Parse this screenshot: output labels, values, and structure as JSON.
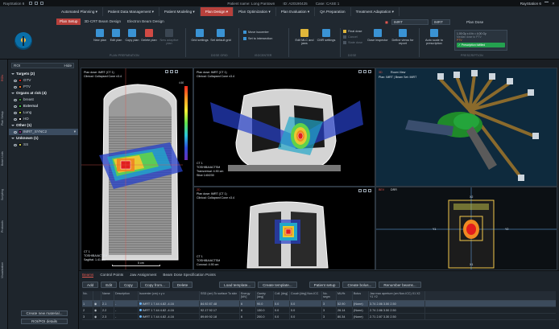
{
  "titlebar": {
    "app_name": "RayStation 6",
    "patient_label": "Patient name: Long Pantown",
    "patient_id": "ID: A20190425",
    "case_label": "Case: CASE 1",
    "right_label": "RayStation 6"
  },
  "workflow_tabs": [
    {
      "label": "Automated Planning ▾",
      "active": false
    },
    {
      "label": "Patient Data Management ▾",
      "active": false
    },
    {
      "label": "Patient Modeling ▾",
      "active": false
    },
    {
      "label": "Plan Design ▾",
      "active": true
    },
    {
      "label": "Plan Optimization ▾",
      "active": false
    },
    {
      "label": "Plan Evaluation ▾",
      "active": false
    },
    {
      "label": "QA Preparation",
      "active": false
    },
    {
      "label": "Treatment Adaptation ▾",
      "active": false
    }
  ],
  "plan_selector": {
    "value": "IMRT",
    "beamset": "IMRT",
    "plan_dose": "Plan Dose"
  },
  "sub_tabs": [
    {
      "label": "Plan Setup",
      "active": true
    },
    {
      "label": "3D-CRT Beam Design",
      "active": false
    },
    {
      "label": "Electron Beam Design",
      "active": false
    }
  ],
  "commands": {
    "new_plan": "New plan",
    "edit_plan": "Edit plan",
    "copy_plan": "Copy plan",
    "delete_plan": "Delete plan",
    "new_adaptive": "New adaptive plan",
    "grid_settings": "Grid settings",
    "set_default_grid": "Set default grid",
    "move_isocenter": "Move isocenter",
    "set_to_intersection": "Set to intersection",
    "edit_mlc": "Edit MLC and jaws",
    "cmr_settings": "CMR settings",
    "final_dose": "Final dose",
    "cancel": "Cancel",
    "state_dose": "State dose",
    "dose_inspector": "Dose inspector",
    "define_views": "Define views for report",
    "auto_scale": "Auto scale to prescription",
    "group_plan_prep": "PLAN PREPARATION",
    "group_dose_grid": "DOSE GRID",
    "group_isocenter": "ISOCENTER",
    "group_dose": "DOSE",
    "group_prescription": "PRESCRIPTION"
  },
  "prescription": {
    "line1": "1.00 Gy x 4 fx = 4.00 Gy",
    "line2": "Median dose to PTV",
    "line3": "PTV",
    "fulfilled": "Prescription fulfilled"
  },
  "left_bar": [
    "ROIs",
    "Plan Setup",
    "Beam Lists",
    "Scripting",
    "Protocols",
    "Visualization"
  ],
  "roi_panel": {
    "select_value": "ROI",
    "select_right": "Hide",
    "groups": [
      {
        "title": "Targets (2)",
        "items": [
          {
            "name": "GTV",
            "color": "#e21d1d"
          },
          {
            "name": "PTV",
            "color": "#e8702a"
          }
        ]
      },
      {
        "title": "Organs at risk (4)",
        "items": [
          {
            "name": "breast",
            "color": "#2e9e3a"
          },
          {
            "name": "External",
            "color": "#39c648",
            "bold": true
          },
          {
            "name": "Lung",
            "color": "#a7c63a"
          },
          {
            "name": "HD",
            "color": "#e9e9e9"
          }
        ]
      },
      {
        "title": "Other (1)",
        "items": [
          {
            "name": "IMRT_SYNC2",
            "color": "#8b2d8b",
            "highlight": true
          }
        ]
      },
      {
        "title": "Unknown (1)",
        "items": [
          {
            "name": "SS",
            "color": "#c7c74a"
          }
        ]
      }
    ],
    "btn_new_material": "Create new material...",
    "btn_roi_details": "ROI/POI details"
  },
  "viewports": {
    "sagittal": {
      "title": "Plan dose: IMRT (CT 1)",
      "subtitle": "Clinical: Collapsed Cone v3.4",
      "bl1": "CT 1",
      "bl2": "TOSHIBA/ACTSM",
      "bl3": "Sagittal: 1.41 cm",
      "scale": "5 cm",
      "cb_top": "4.60",
      "cb_vals": [
        "4.40",
        "4.20",
        "4.00",
        "3.80",
        "3.60",
        "3.20",
        "3.00",
        "2.80",
        "2.40",
        "2.00",
        "1.60",
        "1.20",
        "0.80"
      ]
    },
    "axial": {
      "title": "Plan dose: IMRT (CT 1)",
      "subtitle": "Clinical: Collapsed Cone v3.4",
      "bl1": "CT 1",
      "bl2": "TOSHIBA/ACTSM",
      "bl3": "Transversal: 4.90 cm",
      "bl4": "Slice 140/230",
      "tag": "2D"
    },
    "room": {
      "title": "Plan: IMRT | Beam Set: IMRT",
      "tag": "3D",
      "tag2": "Room View"
    },
    "coronal": {
      "title": "Plan dose: IMRT (CT 1)",
      "subtitle": "Clinical: Collapsed Cone v3.4",
      "bl1": "CT 1",
      "bl2": "TOSHIBA/ACTSM",
      "bl3": "Coronal: 4.90 cm",
      "tag": "2D"
    },
    "bev": {
      "tag": "BEV",
      "tag2": "DRR",
      "label_y1": "Y1",
      "label_y2": "Y2",
      "label_x1": "X1",
      "label_x2": "X2"
    }
  },
  "beams_panel": {
    "tabs": [
      {
        "label": "Beams",
        "active": true
      },
      {
        "label": "Control Points",
        "active": false
      },
      {
        "label": "Jaw Assignment",
        "active": false
      },
      {
        "label": "Beam Dose Specification Points",
        "active": false
      }
    ],
    "buttons": [
      "Add",
      "Edit",
      "Copy",
      "Copy from...",
      "Delete",
      "Load template...",
      "Create template...",
      "Patient setup",
      "Create bolus...",
      "Renumber beams..."
    ],
    "columns": [
      "No.",
      "",
      "Name",
      "Description",
      "Isocenter (cm) x   y   z",
      "SSD (cm) To surface  To skin",
      "Energy [MV]",
      "Gantry [deg]",
      "Coll. [deg]",
      "Couch [deg] Non-ICC",
      "No. segm",
      "MU/fx",
      "Bolus",
      "Jaw max aperture (cm Non-ICC) X1  X2  Y1  Y2"
    ],
    "rows": [
      {
        "no": "1",
        "name": "2.1",
        "desc": "-",
        "iso": "IMRT 1  7.44  4.82  -4.16",
        "ssd": "84.92   87.48",
        "energy": "6",
        "gantry": "90.0",
        "coll": "0.0",
        "couch": "0.0",
        "segm": "3",
        "mu": "52.90",
        "bolus": "(None)",
        "jaw": "3.74  2.86  3.50  2.50",
        "selected": true
      },
      {
        "no": "2",
        "name": "2.2",
        "desc": "-",
        "iso": "IMRT 1  7.44  4.82  -4.16",
        "ssd": "92.17   92.17",
        "energy": "6",
        "gantry": "130.0",
        "coll": "0.0",
        "couch": "0.0",
        "segm": "3",
        "mu": "26.14",
        "bolus": "(None)",
        "jaw": "2.74  2.86  3.50  2.50",
        "selected": false
      },
      {
        "no": "3",
        "name": "2.3",
        "desc": "-",
        "iso": "IMRT 1  7.44  4.82  -4.16",
        "ssd": "89.69   92.18",
        "energy": "6",
        "gantry": "200.0",
        "coll": "0.0",
        "couch": "0.0",
        "segm": "3",
        "mu": "80.34",
        "bolus": "(None)",
        "jaw": "2.71  2.87  3.30  2.50",
        "selected": false
      }
    ]
  }
}
